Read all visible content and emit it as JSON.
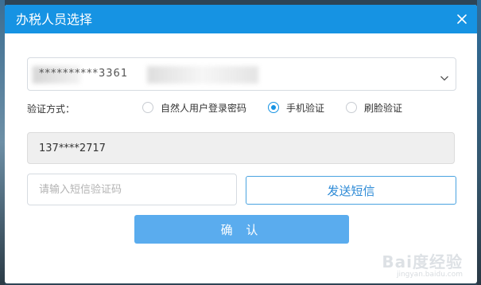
{
  "dialog": {
    "title": "办税人员选择"
  },
  "account_select": {
    "value": "**********3361"
  },
  "verify": {
    "label": "验证方式：",
    "options": [
      {
        "label": "自然人用户登录密码",
        "selected": false
      },
      {
        "label": "手机验证",
        "selected": true
      },
      {
        "label": "刷脸验证",
        "selected": false
      }
    ]
  },
  "phone": {
    "value": "137****2717"
  },
  "sms": {
    "placeholder": "请输入短信验证码",
    "send_label": "发送短信"
  },
  "confirm_label": "确 认",
  "watermark": {
    "main": "Bai度经验",
    "sub": "jingyan.baidu.com"
  },
  "colors": {
    "accent": "#1693e3",
    "confirm": "#5aacee"
  }
}
